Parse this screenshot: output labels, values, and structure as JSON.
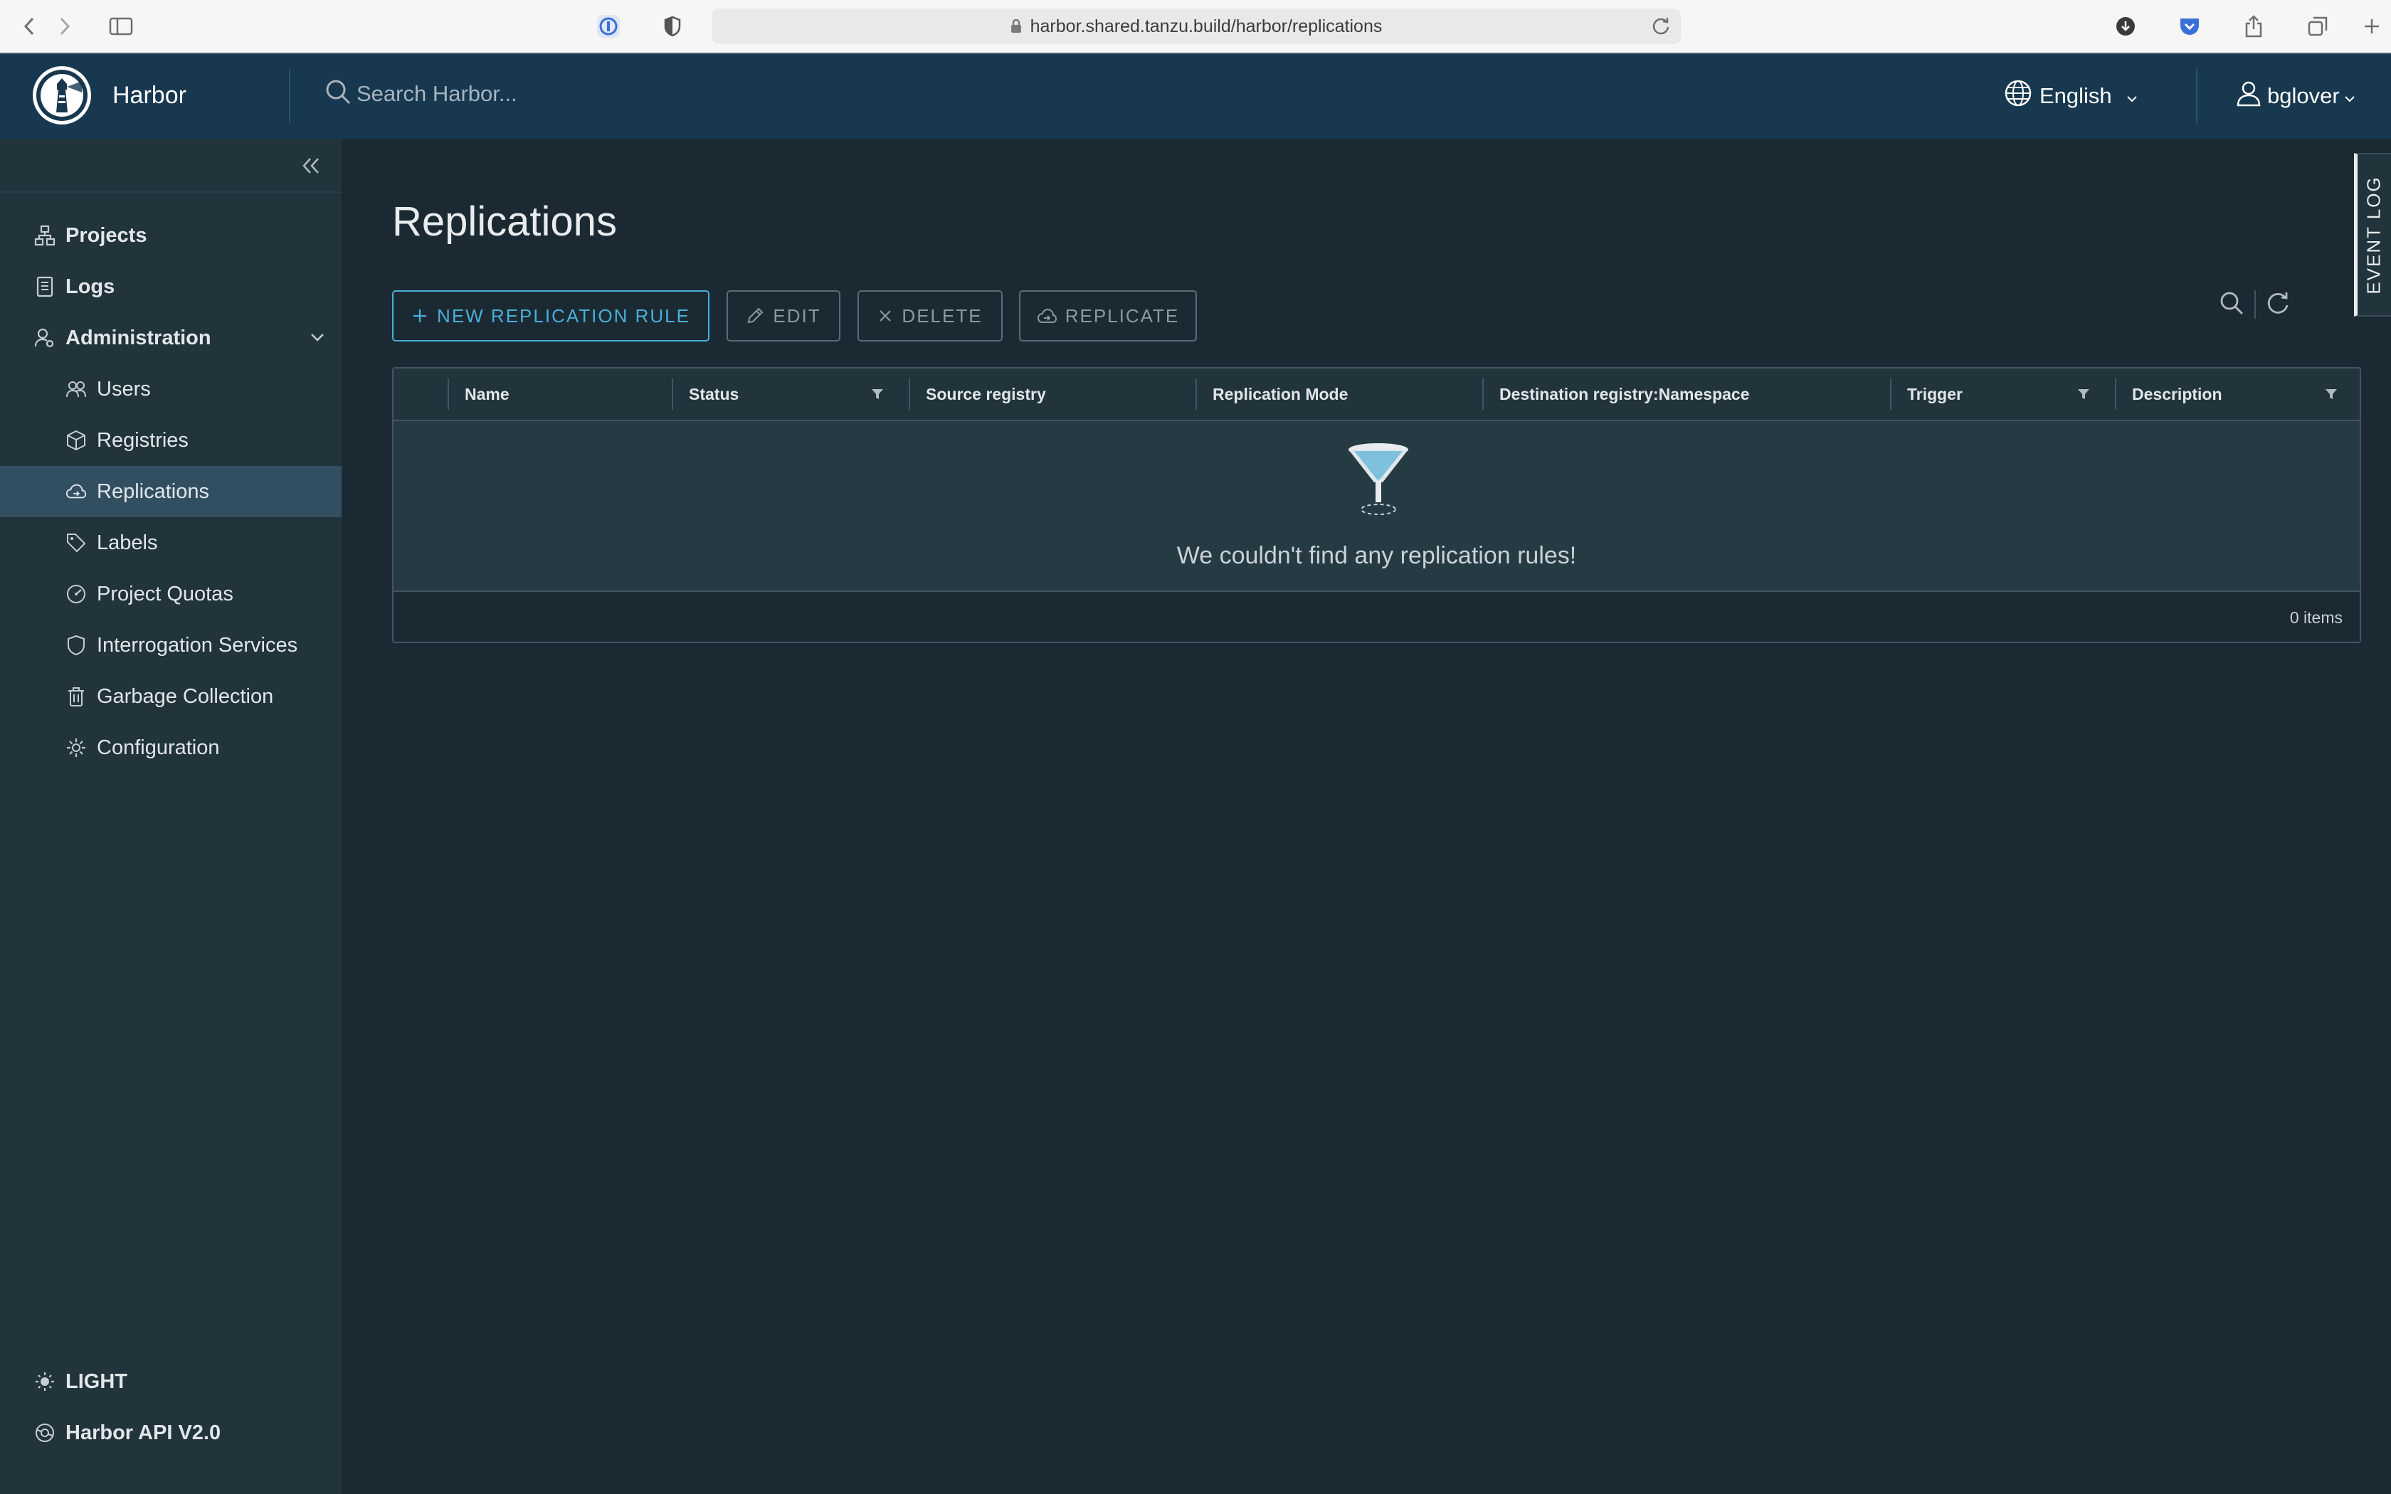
{
  "browser": {
    "url": "harbor.shared.tanzu.build/harbor/replications"
  },
  "header": {
    "app_name": "Harbor",
    "search_placeholder": "Search Harbor...",
    "language": "English",
    "username": "bglover"
  },
  "sidebar": {
    "items": [
      {
        "label": "Projects",
        "icon": "projects-icon",
        "level": "top"
      },
      {
        "label": "Logs",
        "icon": "logs-icon",
        "level": "top"
      },
      {
        "label": "Administration",
        "icon": "administration-icon",
        "level": "top",
        "expanded": true
      },
      {
        "label": "Users",
        "icon": "users-icon",
        "level": "sub"
      },
      {
        "label": "Registries",
        "icon": "registries-icon",
        "level": "sub"
      },
      {
        "label": "Replications",
        "icon": "replications-icon",
        "level": "sub",
        "active": true
      },
      {
        "label": "Labels",
        "icon": "labels-icon",
        "level": "sub"
      },
      {
        "label": "Project Quotas",
        "icon": "project-quotas-icon",
        "level": "sub"
      },
      {
        "label": "Interrogation Services",
        "icon": "interrogation-services-icon",
        "level": "sub"
      },
      {
        "label": "Garbage Collection",
        "icon": "garbage-collection-icon",
        "level": "sub"
      },
      {
        "label": "Configuration",
        "icon": "configuration-icon",
        "level": "sub"
      }
    ],
    "theme_toggle": "LIGHT",
    "api_link": "Harbor API V2.0"
  },
  "main": {
    "title": "Replications",
    "toolbar": {
      "new_rule": "NEW REPLICATION RULE",
      "edit": "EDIT",
      "delete": "DELETE",
      "replicate": "REPLICATE"
    },
    "table": {
      "columns": [
        "Name",
        "Status",
        "Source registry",
        "Replication Mode",
        "Destination registry:Namespace",
        "Trigger",
        "Description"
      ],
      "empty_message": "We couldn't find any replication rules!",
      "footer": "0 items"
    },
    "event_log": "EVENT LOG"
  },
  "colors": {
    "header_bg": "#17384f",
    "sidebar_bg": "#21333b",
    "main_bg": "#1b2a32",
    "accent": "#4aaed9",
    "active_item": "#324f61"
  }
}
